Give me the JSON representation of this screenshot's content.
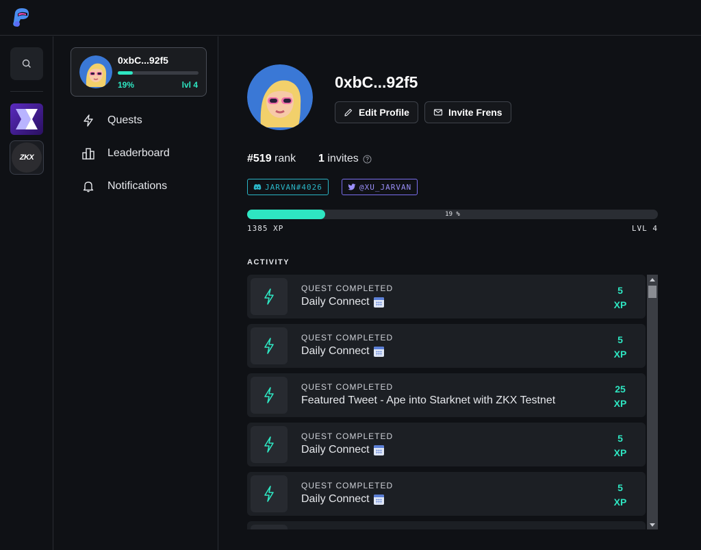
{
  "rail": {
    "apps": [
      "x-app-logo",
      "zkx-app-logo"
    ],
    "zkx_label": "ZKX"
  },
  "user": {
    "short_name": "0xbC...92f5",
    "progress_pct_label": "19%",
    "progress_fraction": 0.19,
    "level_label": "lvl 4"
  },
  "nav": {
    "items": [
      {
        "label": "Quests",
        "icon": "lightning-icon"
      },
      {
        "label": "Leaderboard",
        "icon": "leaderboard-icon"
      },
      {
        "label": "Notifications",
        "icon": "bell-icon"
      }
    ]
  },
  "profile": {
    "name": "0xbC...92f5",
    "edit_label": "Edit Profile",
    "invite_label": "Invite Frens",
    "rank_value": "#519",
    "rank_label": "rank",
    "invites_value": "1",
    "invites_label": "invites",
    "discord_tag": "JARVAN#4026",
    "twitter_tag": "@XU_JARVAN"
  },
  "xp": {
    "fraction": 0.19,
    "pct_label": "19 %",
    "xp_label": "1385 XP",
    "level_label": "LVL 4"
  },
  "activity": {
    "title": "ACTIVITY",
    "items": [
      {
        "kind": "QUEST COMPLETED",
        "title": "Daily Connect",
        "calendar": true,
        "xp": "5",
        "unit": "XP"
      },
      {
        "kind": "QUEST COMPLETED",
        "title": "Daily Connect",
        "calendar": true,
        "xp": "5",
        "unit": "XP"
      },
      {
        "kind": "QUEST COMPLETED",
        "title": "Featured Tweet - Ape into Starknet with ZKX Testnet",
        "calendar": false,
        "xp": "25",
        "unit": "XP"
      },
      {
        "kind": "QUEST COMPLETED",
        "title": "Daily Connect",
        "calendar": true,
        "xp": "5",
        "unit": "XP"
      },
      {
        "kind": "QUEST COMPLETED",
        "title": "Daily Connect",
        "calendar": true,
        "xp": "5",
        "unit": "XP"
      },
      {
        "kind": "",
        "title": "",
        "calendar": false,
        "xp": "",
        "unit": ""
      }
    ]
  },
  "colors": {
    "accent": "#2ee6c2",
    "discord": "#2bb6c7",
    "twitter": "#7b6ff0"
  }
}
